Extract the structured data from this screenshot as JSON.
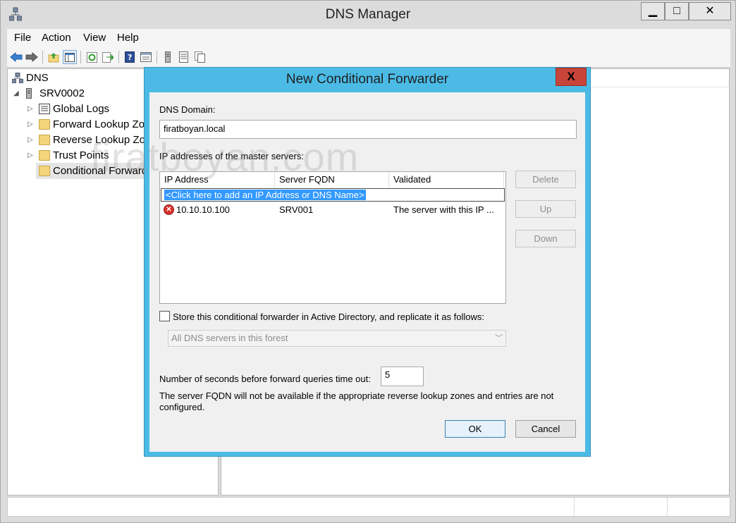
{
  "window": {
    "title": "DNS Manager",
    "min_glyph": "▁",
    "max_glyph": "□",
    "close_glyph": "✕"
  },
  "menu": [
    "File",
    "Action",
    "View",
    "Help"
  ],
  "tree": {
    "root": "DNS",
    "server": "SRV0002",
    "items": [
      "Global Logs",
      "Forward Lookup Zo",
      "Reverse Lookup Zor",
      "Trust Points",
      "Conditional Forward"
    ]
  },
  "watermark": "firatboyan.com",
  "dialog": {
    "title": "New Conditional Forwarder",
    "close_glyph": "X",
    "dns_domain_label": "DNS Domain:",
    "dns_domain_value": "firatboyan.local",
    "master_servers_label": "IP addresses of the master servers:",
    "columns": [
      "IP Address",
      "Server FQDN",
      "Validated"
    ],
    "add_row_text": "<Click here to add an IP Address or DNS Name>",
    "rows": [
      {
        "ip": "10.10.10.100",
        "fqdn": "SRV001",
        "validated": "The server with this IP ..."
      }
    ],
    "side_buttons": {
      "delete": "Delete",
      "up": "Up",
      "down": "Down"
    },
    "store_ad_label": "Store this conditional forwarder in Active Directory, and replicate it as follows:",
    "replication_value": "All DNS servers in this forest",
    "timeout_label": "Number of seconds before forward queries time out:",
    "timeout_value": "5",
    "note": "The server FQDN will not be available if the appropriate reverse lookup zones and entries are not configured.",
    "ok": "OK",
    "cancel": "Cancel"
  },
  "colors": {
    "dialog_frame": "#4bbbe6",
    "close_button": "#c8443a",
    "selection": "#3399ff",
    "error": "#d8312a"
  },
  "icons": [
    "back-icon",
    "forward-icon",
    "folder-up-icon",
    "show-tree-icon",
    "refresh-icon",
    "export-icon",
    "help-icon",
    "properties-icon",
    "server-icon",
    "list-icon",
    "copy-icon"
  ]
}
